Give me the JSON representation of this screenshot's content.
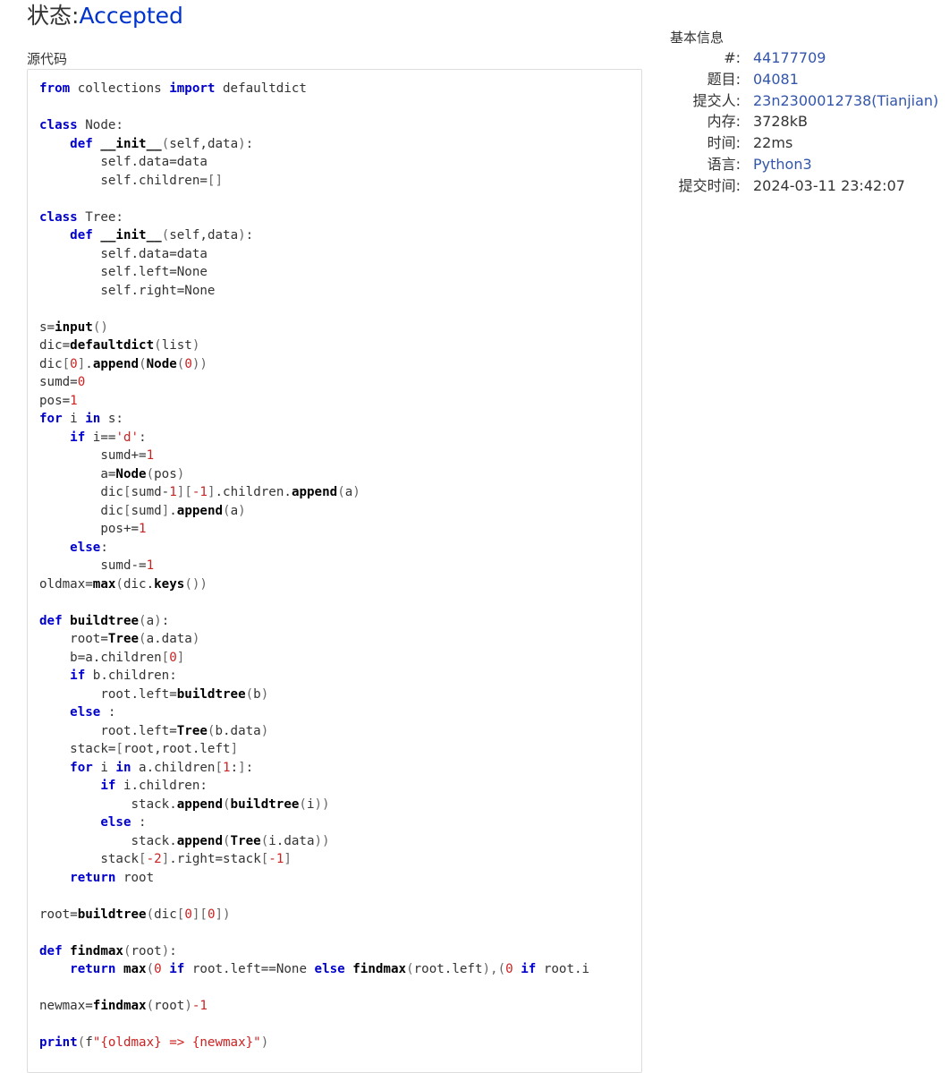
{
  "header": {
    "status_label": "状态:",
    "status_value": "Accepted"
  },
  "source": {
    "label": "源代码"
  },
  "info": {
    "title": "基本信息",
    "rows": [
      {
        "label": "#:",
        "value": "44177709",
        "link": true
      },
      {
        "label": "题目:",
        "value": "04081",
        "link": true
      },
      {
        "label": "提交人:",
        "value": "23n2300012738(Tianjian)",
        "link": true
      },
      {
        "label": "内存:",
        "value": "3728kB",
        "link": false
      },
      {
        "label": "时间:",
        "value": "22ms",
        "link": false
      },
      {
        "label": "语言:",
        "value": "Python3",
        "link": true
      },
      {
        "label": "提交时间:",
        "value": "2024-03-11 23:42:07",
        "link": false
      }
    ]
  },
  "code": {
    "lines": [
      [
        [
          "kw",
          "from"
        ],
        [
          "t",
          " collections "
        ],
        [
          "kw",
          "import"
        ],
        [
          "t",
          " defaultdict"
        ]
      ],
      [],
      [
        [
          "kw",
          "class"
        ],
        [
          "t",
          " Node:"
        ]
      ],
      [
        [
          "t",
          "    "
        ],
        [
          "kw",
          "def"
        ],
        [
          "t",
          " "
        ],
        [
          "fn",
          "__init__"
        ],
        [
          "pu",
          "("
        ],
        [
          "t",
          "self,data"
        ],
        [
          "pu",
          ")"
        ],
        [
          "t",
          ":"
        ]
      ],
      [
        [
          "t",
          "        self.data=data"
        ]
      ],
      [
        [
          "t",
          "        self.children="
        ],
        [
          "pu",
          "[]"
        ]
      ],
      [],
      [
        [
          "kw",
          "class"
        ],
        [
          "t",
          " Tree:"
        ]
      ],
      [
        [
          "t",
          "    "
        ],
        [
          "kw",
          "def"
        ],
        [
          "t",
          " "
        ],
        [
          "fn",
          "__init__"
        ],
        [
          "pu",
          "("
        ],
        [
          "t",
          "self,data"
        ],
        [
          "pu",
          ")"
        ],
        [
          "t",
          ":"
        ]
      ],
      [
        [
          "t",
          "        self.data=data"
        ]
      ],
      [
        [
          "t",
          "        self.left=None"
        ]
      ],
      [
        [
          "t",
          "        self.right=None"
        ]
      ],
      [],
      [
        [
          "t",
          "s="
        ],
        [
          "fn",
          "input"
        ],
        [
          "pu",
          "()"
        ]
      ],
      [
        [
          "t",
          "dic="
        ],
        [
          "fn",
          "defaultdict"
        ],
        [
          "pu",
          "("
        ],
        [
          "t",
          "list"
        ],
        [
          "pu",
          ")"
        ]
      ],
      [
        [
          "t",
          "dic"
        ],
        [
          "pu",
          "["
        ],
        [
          "num",
          "0"
        ],
        [
          "pu",
          "]"
        ],
        [
          "t",
          "."
        ],
        [
          "fn",
          "append"
        ],
        [
          "pu",
          "("
        ],
        [
          "fn",
          "Node"
        ],
        [
          "pu",
          "("
        ],
        [
          "num",
          "0"
        ],
        [
          "pu",
          "))"
        ]
      ],
      [
        [
          "t",
          "sumd="
        ],
        [
          "num",
          "0"
        ]
      ],
      [
        [
          "t",
          "pos="
        ],
        [
          "num",
          "1"
        ]
      ],
      [
        [
          "kw",
          "for"
        ],
        [
          "t",
          " i "
        ],
        [
          "kw",
          "in"
        ],
        [
          "t",
          " s:"
        ]
      ],
      [
        [
          "t",
          "    "
        ],
        [
          "kw",
          "if"
        ],
        [
          "t",
          " i=="
        ],
        [
          "str",
          "'d'"
        ],
        [
          "t",
          ":"
        ]
      ],
      [
        [
          "t",
          "        sumd+="
        ],
        [
          "num",
          "1"
        ]
      ],
      [
        [
          "t",
          "        a="
        ],
        [
          "fn",
          "Node"
        ],
        [
          "pu",
          "("
        ],
        [
          "t",
          "pos"
        ],
        [
          "pu",
          ")"
        ]
      ],
      [
        [
          "t",
          "        dic"
        ],
        [
          "pu",
          "["
        ],
        [
          "t",
          "sumd-"
        ],
        [
          "num",
          "1"
        ],
        [
          "pu",
          "]["
        ],
        [
          "num",
          "-1"
        ],
        [
          "pu",
          "]"
        ],
        [
          "t",
          ".children."
        ],
        [
          "fn",
          "append"
        ],
        [
          "pu",
          "("
        ],
        [
          "t",
          "a"
        ],
        [
          "pu",
          ")"
        ]
      ],
      [
        [
          "t",
          "        dic"
        ],
        [
          "pu",
          "["
        ],
        [
          "t",
          "sumd"
        ],
        [
          "pu",
          "]"
        ],
        [
          "t",
          "."
        ],
        [
          "fn",
          "append"
        ],
        [
          "pu",
          "("
        ],
        [
          "t",
          "a"
        ],
        [
          "pu",
          ")"
        ]
      ],
      [
        [
          "t",
          "        pos+="
        ],
        [
          "num",
          "1"
        ]
      ],
      [
        [
          "t",
          "    "
        ],
        [
          "kw",
          "else"
        ],
        [
          "t",
          ":"
        ]
      ],
      [
        [
          "t",
          "        sumd-="
        ],
        [
          "num",
          "1"
        ]
      ],
      [
        [
          "t",
          "oldmax="
        ],
        [
          "fn",
          "max"
        ],
        [
          "pu",
          "("
        ],
        [
          "t",
          "dic."
        ],
        [
          "fn",
          "keys"
        ],
        [
          "pu",
          "())"
        ]
      ],
      [],
      [
        [
          "kw",
          "def"
        ],
        [
          "t",
          " "
        ],
        [
          "fn",
          "buildtree"
        ],
        [
          "pu",
          "("
        ],
        [
          "t",
          "a"
        ],
        [
          "pu",
          ")"
        ],
        [
          "t",
          ":"
        ]
      ],
      [
        [
          "t",
          "    root="
        ],
        [
          "fn",
          "Tree"
        ],
        [
          "pu",
          "("
        ],
        [
          "t",
          "a.data"
        ],
        [
          "pu",
          ")"
        ]
      ],
      [
        [
          "t",
          "    b=a.children"
        ],
        [
          "pu",
          "["
        ],
        [
          "num",
          "0"
        ],
        [
          "pu",
          "]"
        ]
      ],
      [
        [
          "t",
          "    "
        ],
        [
          "kw",
          "if"
        ],
        [
          "t",
          " b.children:"
        ]
      ],
      [
        [
          "t",
          "        root.left="
        ],
        [
          "fn",
          "buildtree"
        ],
        [
          "pu",
          "("
        ],
        [
          "t",
          "b"
        ],
        [
          "pu",
          ")"
        ]
      ],
      [
        [
          "t",
          "    "
        ],
        [
          "kw",
          "else"
        ],
        [
          "t",
          " :"
        ]
      ],
      [
        [
          "t",
          "        root.left="
        ],
        [
          "fn",
          "Tree"
        ],
        [
          "pu",
          "("
        ],
        [
          "t",
          "b.data"
        ],
        [
          "pu",
          ")"
        ]
      ],
      [
        [
          "t",
          "    stack="
        ],
        [
          "pu",
          "["
        ],
        [
          "t",
          "root,root.left"
        ],
        [
          "pu",
          "]"
        ]
      ],
      [
        [
          "t",
          "    "
        ],
        [
          "kw",
          "for"
        ],
        [
          "t",
          " i "
        ],
        [
          "kw",
          "in"
        ],
        [
          "t",
          " a.children"
        ],
        [
          "pu",
          "["
        ],
        [
          "num",
          "1"
        ],
        [
          "t",
          ":"
        ],
        [
          "pu",
          "]"
        ],
        [
          "t",
          ":"
        ]
      ],
      [
        [
          "t",
          "        "
        ],
        [
          "kw",
          "if"
        ],
        [
          "t",
          " i.children:"
        ]
      ],
      [
        [
          "t",
          "            stack."
        ],
        [
          "fn",
          "append"
        ],
        [
          "pu",
          "("
        ],
        [
          "fn",
          "buildtree"
        ],
        [
          "pu",
          "("
        ],
        [
          "t",
          "i"
        ],
        [
          "pu",
          "))"
        ]
      ],
      [
        [
          "t",
          "        "
        ],
        [
          "kw",
          "else"
        ],
        [
          "t",
          " :"
        ]
      ],
      [
        [
          "t",
          "            stack."
        ],
        [
          "fn",
          "append"
        ],
        [
          "pu",
          "("
        ],
        [
          "fn",
          "Tree"
        ],
        [
          "pu",
          "("
        ],
        [
          "t",
          "i.data"
        ],
        [
          "pu",
          "))"
        ]
      ],
      [
        [
          "t",
          "        stack"
        ],
        [
          "pu",
          "["
        ],
        [
          "num",
          "-2"
        ],
        [
          "pu",
          "]"
        ],
        [
          "t",
          ".right=stack"
        ],
        [
          "pu",
          "["
        ],
        [
          "num",
          "-1"
        ],
        [
          "pu",
          "]"
        ]
      ],
      [
        [
          "t",
          "    "
        ],
        [
          "kw",
          "return"
        ],
        [
          "t",
          " root"
        ]
      ],
      [],
      [
        [
          "t",
          "root="
        ],
        [
          "fn",
          "buildtree"
        ],
        [
          "pu",
          "("
        ],
        [
          "t",
          "dic"
        ],
        [
          "pu",
          "["
        ],
        [
          "num",
          "0"
        ],
        [
          "pu",
          "]["
        ],
        [
          "num",
          "0"
        ],
        [
          "pu",
          "])"
        ]
      ],
      [],
      [
        [
          "kw",
          "def"
        ],
        [
          "t",
          " "
        ],
        [
          "fn",
          "findmax"
        ],
        [
          "pu",
          "("
        ],
        [
          "t",
          "root"
        ],
        [
          "pu",
          ")"
        ],
        [
          "t",
          ":"
        ]
      ],
      [
        [
          "t",
          "    "
        ],
        [
          "kw",
          "return"
        ],
        [
          "t",
          " "
        ],
        [
          "fn",
          "max"
        ],
        [
          "pu",
          "("
        ],
        [
          "num",
          "0"
        ],
        [
          "t",
          " "
        ],
        [
          "kw",
          "if"
        ],
        [
          "t",
          " root.left==None "
        ],
        [
          "kw",
          "else"
        ],
        [
          "t",
          " "
        ],
        [
          "fn",
          "findmax"
        ],
        [
          "pu",
          "("
        ],
        [
          "t",
          "root.left"
        ],
        [
          "pu",
          "),("
        ],
        [
          "num",
          "0"
        ],
        [
          "t",
          " "
        ],
        [
          "kw",
          "if"
        ],
        [
          "t",
          " root.i"
        ]
      ],
      [],
      [
        [
          "t",
          "newmax="
        ],
        [
          "fn",
          "findmax"
        ],
        [
          "pu",
          "("
        ],
        [
          "t",
          "root"
        ],
        [
          "pu",
          ")"
        ],
        [
          "num",
          "-1"
        ]
      ],
      [],
      [
        [
          "kw",
          "print"
        ],
        [
          "pu",
          "("
        ],
        [
          "t",
          "f"
        ],
        [
          "str",
          "\"{oldmax} => {newmax}\""
        ],
        [
          "pu",
          ")"
        ]
      ]
    ]
  }
}
